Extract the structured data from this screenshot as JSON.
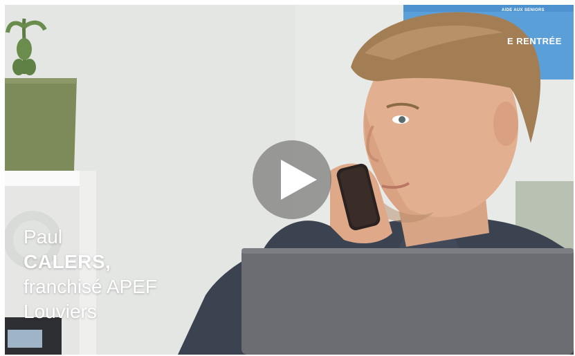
{
  "video": {
    "caption": {
      "first_name": "Paul",
      "last_name": "CALERS,",
      "role": "franchisé APEF",
      "city": "Louviers"
    },
    "poster": {
      "small_text": "AIDE AUX SENIORS",
      "headline": "E RENTRÉE"
    },
    "play_icon": "play-icon"
  },
  "colors": {
    "overlay_play": "#787878",
    "poster_blue": "#5b9fd8",
    "wall": "#e9ebe8"
  }
}
